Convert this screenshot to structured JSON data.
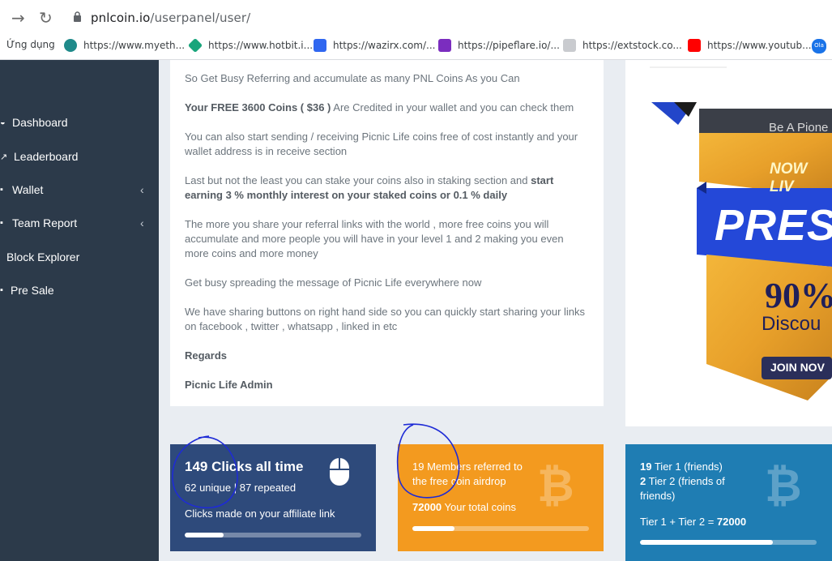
{
  "browser": {
    "url_domain": "pnlcoin.io",
    "url_path": "/userpanel/user/",
    "bookmarks": [
      {
        "label": "Ứng dụng",
        "icon": "apps-icon",
        "color": "#4285f4"
      },
      {
        "label": "https://www.myeth...",
        "icon": "myeth-icon",
        "color": "#1f8a8a"
      },
      {
        "label": "https://www.hotbit.i...",
        "icon": "hotbit-icon",
        "color": "#18a57b"
      },
      {
        "label": "https://wazirx.com/...",
        "icon": "wazirx-icon",
        "color": "#3067f0"
      },
      {
        "label": "https://pipeflare.io/...",
        "icon": "pipeflare-icon",
        "color": "#7b2dbf"
      },
      {
        "label": "https://extstock.co...",
        "icon": "extstock-icon",
        "color": "#9aa0a6"
      },
      {
        "label": "https://www.youtub...",
        "icon": "youtube-icon",
        "color": "#ff0000"
      },
      {
        "label": "Ola",
        "icon": "ola-icon",
        "color": "#1a73e8"
      }
    ]
  },
  "sidebar": {
    "items": [
      {
        "label": "Dashboard",
        "icon": "dashboard-icon"
      },
      {
        "label": "Leaderboard",
        "icon": "chart-icon"
      },
      {
        "label": "Wallet",
        "icon": "wallet-icon",
        "chevron": "‹"
      },
      {
        "label": "Team Report",
        "icon": "team-icon",
        "chevron": "‹"
      },
      {
        "label": "Block Explorer",
        "icon": ""
      },
      {
        "label": "Pre Sale",
        "icon": "presale-icon"
      }
    ]
  },
  "content": {
    "p1": "So Get Busy Referring and accumulate as many PNL Coins As you Can",
    "p2_bold": "Your FREE 3600 Coins ( $36 )",
    "p2_rest": " Are Credited in your wallet and you can check them",
    "p3": "You can also start sending / receiving Picnic Life coins free of cost instantly and your wallet address is in receive section",
    "p4_pre": "Last but not the least you can stake your coins also in staking section and ",
    "p4_bold": "start earning 3 % monthly interest on your staked coins or 0.1 % daily",
    "p5": "The more you share your referral links with the world , more free coins you will accumulate and more people you will have in your level 1 and 2 making you even more coins and more money",
    "p6": "Get busy spreading the message of Picnic Life everywhere now",
    "p7": "We have sharing buttons on right hand side so you can quickly start sharing your links on facebook , twitter , whatsapp , linked in etc",
    "regards": "Regards",
    "signature": "Picnic Life Admin"
  },
  "ad": {
    "line1": "Be A Pione",
    "line2": "NOW LIV",
    "line3": "PRESA",
    "line4": "90%",
    "line5": "Discou",
    "line6": "JOIN NOV"
  },
  "stats": {
    "clicks": {
      "title": "149 Clicks all time",
      "unique": "62 unique",
      "repeated": "87 repeated",
      "caption": "Clicks made on your affiliate link",
      "progress": 0.22
    },
    "members": {
      "line1": "19 Members referred to",
      "line2": "the free coin airdrop",
      "coins_bold": "72000",
      "coins_rest": " Your total coins",
      "progress": 0.24
    },
    "tiers": {
      "t1_bold": "19",
      "t1_rest": " Tier 1 (friends)",
      "t2_bold": "2",
      "t2_rest": " Tier 2 (friends of",
      "t2_line2": "friends)",
      "sum_label": "Tier 1 + Tier 2 = ",
      "sum_bold": "72000",
      "progress": 0.75
    }
  },
  "colors": {
    "sidebar": "#2c3a4a",
    "blue_card": "#2e4a7b",
    "orange_card": "#f39a1f",
    "teal_card": "#1f7db3",
    "annotation": "#1e2bd6"
  }
}
